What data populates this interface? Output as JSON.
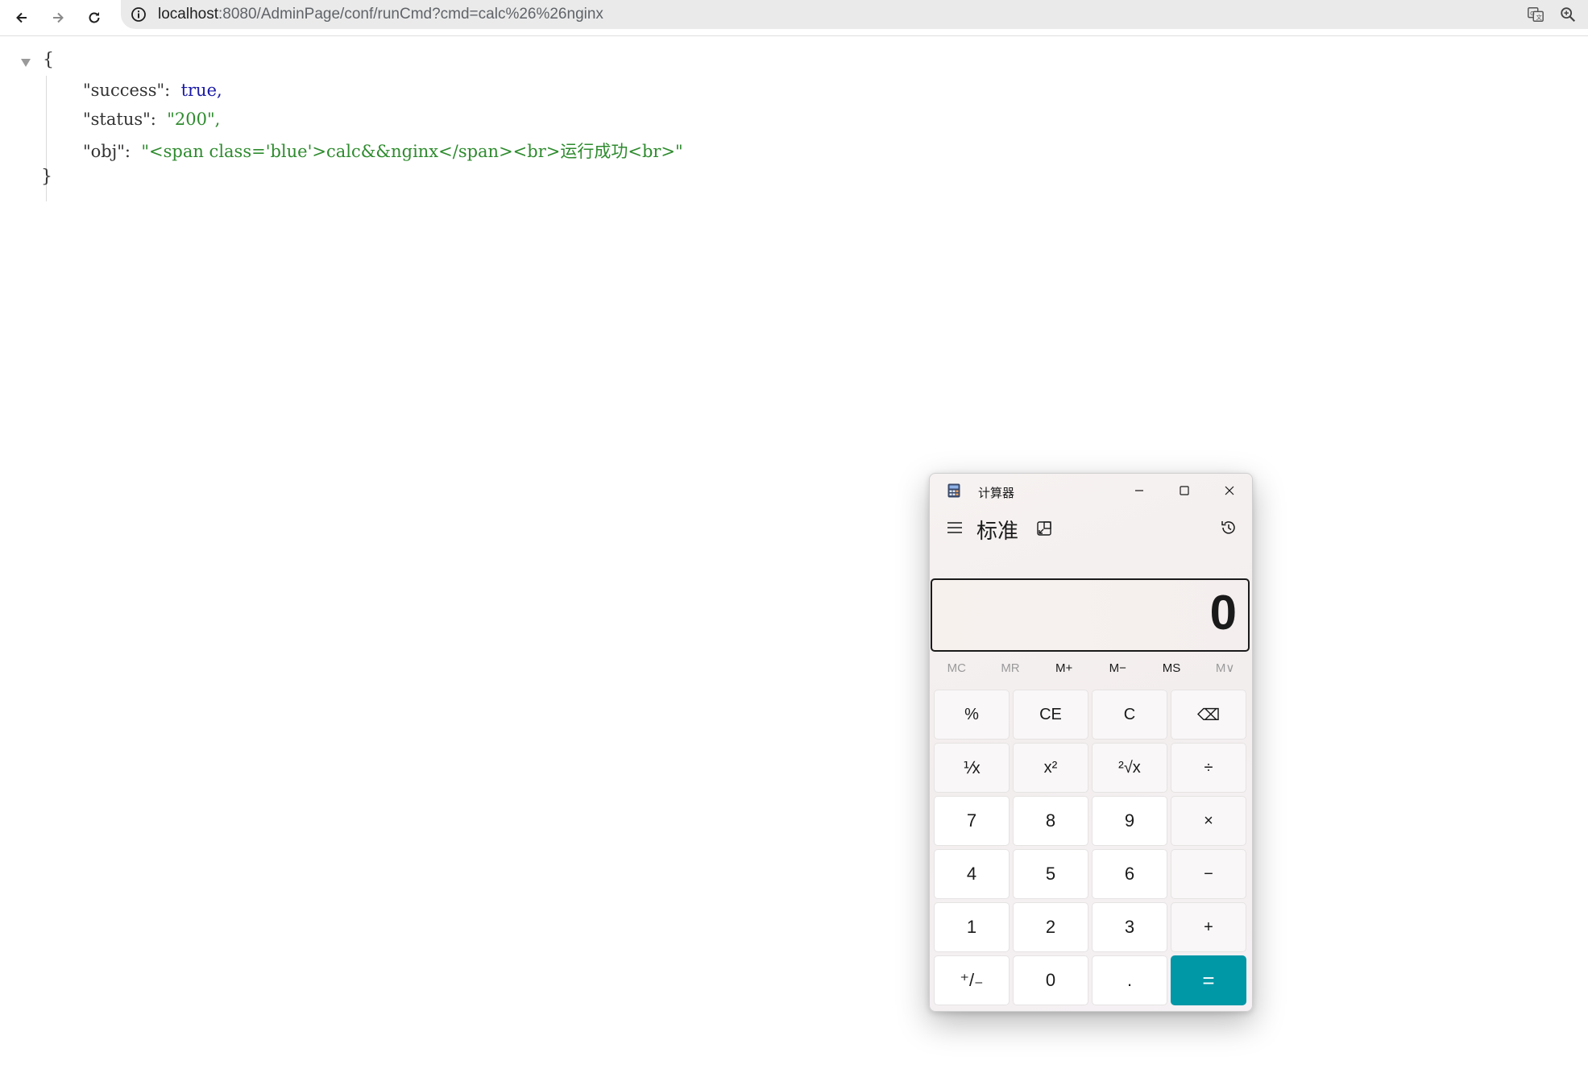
{
  "browser": {
    "url_host": "localhost",
    "url_rest": ":8080/AdminPage/conf/runCmd?cmd=calc%26%26nginx",
    "icons": [
      "back-arrow-icon",
      "forward-arrow-icon",
      "reload-icon",
      "info-icon",
      "translate-icon",
      "zoom-icon"
    ]
  },
  "json": {
    "open_brace": "{",
    "close_brace": "}",
    "lines": [
      {
        "key": "\"success\":",
        "value": "true,"
      },
      {
        "key": "\"status\":",
        "value": "\"200\","
      },
      {
        "key": "\"obj\":",
        "value": "\"<span class='blue'>calc&&nginx</span><br>运行成功<br>\""
      }
    ]
  },
  "calculator": {
    "window_title": "计算器",
    "mode": "标准",
    "display": "0",
    "memory": [
      {
        "label": "MC",
        "enabled": false
      },
      {
        "label": "MR",
        "enabled": false
      },
      {
        "label": "M+",
        "enabled": true
      },
      {
        "label": "M−",
        "enabled": true
      },
      {
        "label": "MS",
        "enabled": true
      },
      {
        "label": "M∨",
        "enabled": false
      }
    ],
    "keys": [
      {
        "label": "%",
        "type": "fn",
        "name": "percent-key"
      },
      {
        "label": "CE",
        "type": "fn",
        "name": "clear-entry-key"
      },
      {
        "label": "C",
        "type": "fn",
        "name": "clear-key"
      },
      {
        "label": "⌫",
        "type": "fn",
        "name": "backspace-key"
      },
      {
        "label": "⅟x",
        "type": "fn",
        "name": "reciprocal-key"
      },
      {
        "label": "x²",
        "type": "fn",
        "name": "square-key"
      },
      {
        "label": "²√x",
        "type": "fn",
        "name": "sqrt-key"
      },
      {
        "label": "÷",
        "type": "fn",
        "name": "divide-key"
      },
      {
        "label": "7",
        "type": "num",
        "name": "digit-7-key"
      },
      {
        "label": "8",
        "type": "num",
        "name": "digit-8-key"
      },
      {
        "label": "9",
        "type": "num",
        "name": "digit-9-key"
      },
      {
        "label": "×",
        "type": "fn",
        "name": "multiply-key"
      },
      {
        "label": "4",
        "type": "num",
        "name": "digit-4-key"
      },
      {
        "label": "5",
        "type": "num",
        "name": "digit-5-key"
      },
      {
        "label": "6",
        "type": "num",
        "name": "digit-6-key"
      },
      {
        "label": "−",
        "type": "fn",
        "name": "subtract-key"
      },
      {
        "label": "1",
        "type": "num",
        "name": "digit-1-key"
      },
      {
        "label": "2",
        "type": "num",
        "name": "digit-2-key"
      },
      {
        "label": "3",
        "type": "num",
        "name": "digit-3-key"
      },
      {
        "label": "+",
        "type": "fn",
        "name": "add-key"
      },
      {
        "label": "⁺/₋",
        "type": "num",
        "name": "negate-key"
      },
      {
        "label": "0",
        "type": "num",
        "name": "digit-0-key"
      },
      {
        "label": ".",
        "type": "num",
        "name": "decimal-key"
      },
      {
        "label": "=",
        "type": "eq",
        "name": "equals-key"
      }
    ],
    "colors": {
      "accent": "#0097a7"
    }
  }
}
